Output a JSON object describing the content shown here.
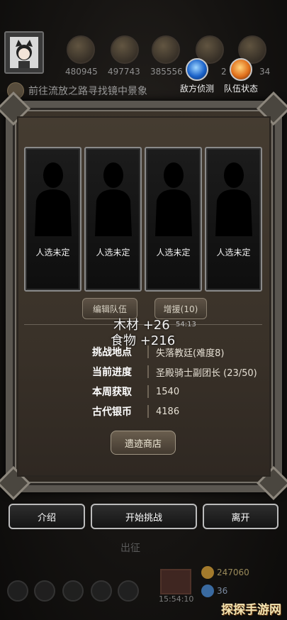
{
  "hud": {
    "resources": [
      {
        "icon": "bread-icon",
        "value": "480945"
      },
      {
        "icon": "log-icon",
        "value": "497743"
      },
      {
        "icon": "ore-icon",
        "value": "385556"
      },
      {
        "icon": "crystal-icon",
        "value": "2"
      },
      {
        "icon": "tool-icon",
        "value": "34"
      }
    ],
    "quest": "前往流放之路寻找镜中景象",
    "enemy_scout": "敌方侦测",
    "team_status": "队伍状态"
  },
  "party": {
    "slots": [
      "人选未定",
      "人选未定",
      "人选未定",
      "人选未定"
    ],
    "edit_team": "编辑队伍",
    "reinforce": "增援(10)"
  },
  "gains": {
    "wood": "木材 +26",
    "food": "食物 +216",
    "time": "54:13"
  },
  "info": {
    "location_key": "挑战地点",
    "location_val": "失落教廷(难度8)",
    "progress_key": "当前进度",
    "progress_val": "圣殿骑士副团长 (23/50)",
    "weekly_key": "本周获取",
    "weekly_val": "1540",
    "silver_key": "古代银币",
    "silver_val": "4186"
  },
  "relic_shop": "遗迹商店",
  "buttons": {
    "intro": "介绍",
    "start": "开始挑战",
    "leave": "离开"
  },
  "footer": {
    "depart": "出征",
    "timer": "15:54:10",
    "gold": "247060",
    "gem": "36",
    "watermark": "探探手游网"
  },
  "colors": {
    "scout_orb": "#1a62c9",
    "status_orb": "#e0701c",
    "gold": "#d8a53a"
  }
}
